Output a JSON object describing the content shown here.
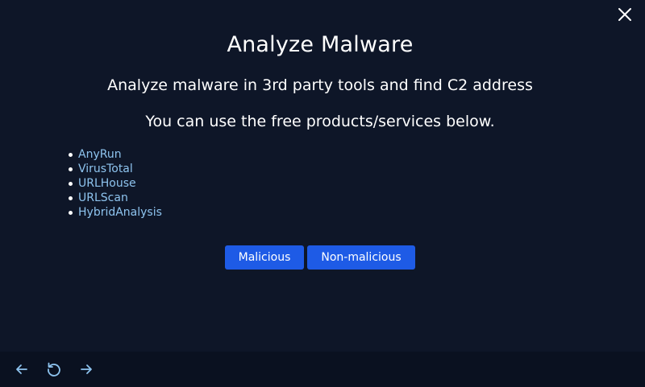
{
  "modal": {
    "title": "Analyze Malware",
    "description": "Analyze malware in 3rd party tools and find C2 address",
    "hint": "You can use the free products/services below.",
    "tools": [
      {
        "label": "AnyRun"
      },
      {
        "label": "VirusTotal"
      },
      {
        "label": "URLHouse"
      },
      {
        "label": "URLScan"
      },
      {
        "label": "HybridAnalysis"
      }
    ],
    "buttons": {
      "malicious_label": "Malicious",
      "non_malicious_label": "Non-malicious"
    },
    "close_icon": "close-icon"
  },
  "footer": {
    "icons": [
      "arrow-left-icon",
      "reload-icon",
      "arrow-right-icon"
    ]
  },
  "colors": {
    "background": "#0e1628",
    "footer_background": "#0a1120",
    "link": "#8ec4ef",
    "button": "#1e5be6"
  }
}
